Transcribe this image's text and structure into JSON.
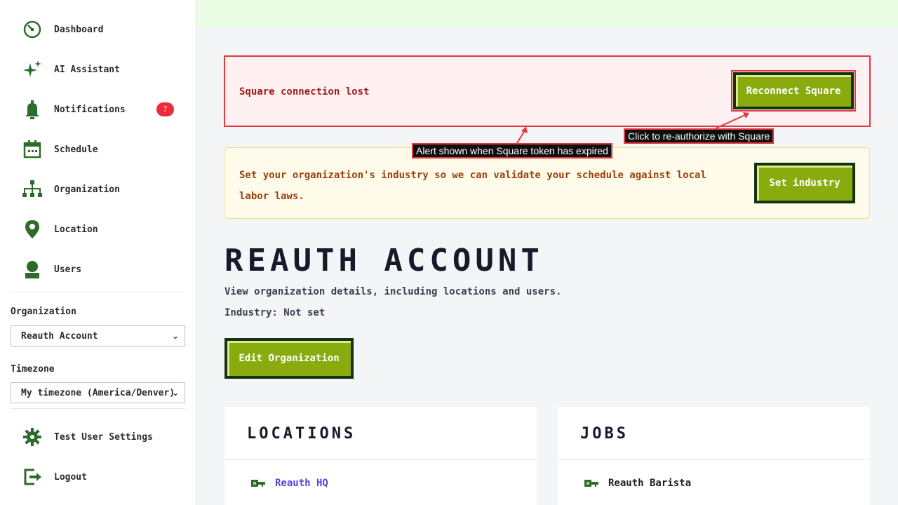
{
  "sidebar": {
    "items": [
      {
        "label": "Dashboard",
        "icon": "dashboard-icon"
      },
      {
        "label": "AI Assistant",
        "icon": "sparkle-icon"
      },
      {
        "label": "Notifications",
        "icon": "bell-icon",
        "badge": "7"
      },
      {
        "label": "Schedule",
        "icon": "calendar-icon"
      },
      {
        "label": "Organization",
        "icon": "org-chart-icon"
      },
      {
        "label": "Location",
        "icon": "map-pin-icon"
      },
      {
        "label": "Users",
        "icon": "user-icon"
      }
    ],
    "organization_label": "Organization",
    "organization_value": "Reauth Account",
    "timezone_label": "Timezone",
    "timezone_value": "My timezone (America/Denver)",
    "bottom_items": [
      {
        "label": "Test User Settings",
        "icon": "gear-icon"
      },
      {
        "label": "Logout",
        "icon": "logout-icon"
      }
    ]
  },
  "alerts": {
    "square": {
      "message": "Square connection lost",
      "button": "Reconnect Square",
      "tooltip_button": "Click to re-authorize with Square",
      "tooltip_alert": "Alert shown when Square token has expired"
    },
    "industry": {
      "message": "Set your organization's industry so we can validate your schedule against local labor laws.",
      "button": "Set industry"
    }
  },
  "page": {
    "title": "REAUTH ACCOUNT",
    "description": "View organization details, including locations and users.",
    "industry": "Industry: Not set",
    "edit_button": "Edit Organization"
  },
  "cards": {
    "locations": {
      "title": "LOCATIONS",
      "items": [
        "Reauth HQ"
      ]
    },
    "jobs": {
      "title": "JOBS",
      "items": [
        "Reauth Barista"
      ]
    }
  },
  "colors": {
    "accent_green": "#8aab0e",
    "dark_green": "#15320f",
    "alert_red": "#e3383f",
    "link_purple": "#5b3fe0",
    "badge_red": "#ef2b3b"
  }
}
